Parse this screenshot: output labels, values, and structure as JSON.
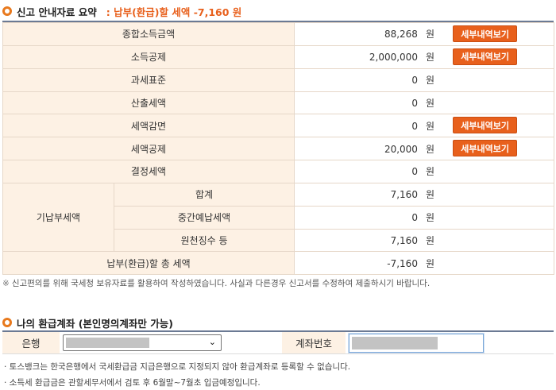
{
  "guide": {
    "title": "신고 안내자료 요약",
    "summary": ": 납부(환급)할 세액 -7,160 원",
    "detail_label": "세부내역보기",
    "unit": "원",
    "rows": [
      {
        "label": "종합소득금액",
        "value": "88,268",
        "detail": true
      },
      {
        "label": "소득공제",
        "value": "2,000,000",
        "detail": true
      },
      {
        "label": "과세표준",
        "value": "0",
        "detail": false
      },
      {
        "label": "산출세액",
        "value": "0",
        "detail": false
      },
      {
        "label": "세액감면",
        "value": "0",
        "detail": true
      },
      {
        "label": "세액공제",
        "value": "20,000",
        "detail": true
      },
      {
        "label": "결정세액",
        "value": "0",
        "detail": false
      }
    ],
    "prepaid": {
      "group_label": "기납부세액",
      "rows": [
        {
          "label": "합계",
          "value": "7,160"
        },
        {
          "label": "중간예납세액",
          "value": "0"
        },
        {
          "label": "원천징수 등",
          "value": "7,160"
        }
      ]
    },
    "total": {
      "label": "납부(환급)할 총 세액",
      "value": "-7,160"
    },
    "notice_mark": "※",
    "notice": "신고편의를 위해 국세청 보유자료를 활용하여 작성하였습니다. 사실과 다른경우 신고서를 수정하여 제출하시기 바랍니다."
  },
  "account": {
    "title": "나의 환급계좌 (본인명의계좌만 가능)",
    "bank_label": "은행",
    "account_label": "계좌번호",
    "notes": [
      "· 토스뱅크는 한국은행에서 국세환급금 지급은행으로 지정되지 않아 환급계좌로 등록할 수 없습니다.",
      "· 소득세 환급금은 관할세무서에서 검토 후 6월말~7월초 입금예정입니다."
    ]
  }
}
